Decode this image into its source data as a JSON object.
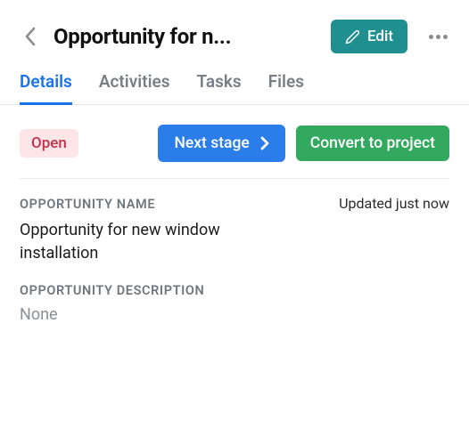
{
  "header": {
    "title": "Opportunity for n...",
    "edit_label": "Edit"
  },
  "tabs": [
    {
      "id": "details",
      "label": "Details",
      "active": true
    },
    {
      "id": "activities",
      "label": "Activities",
      "active": false
    },
    {
      "id": "tasks",
      "label": "Tasks",
      "active": false
    },
    {
      "id": "files",
      "label": "Files",
      "active": false
    }
  ],
  "status": {
    "label": "Open"
  },
  "actions": {
    "next_stage_label": "Next stage",
    "convert_label": "Convert to project"
  },
  "meta": {
    "updated_text": "Updated just now"
  },
  "fields": {
    "opportunity_name": {
      "label": "OPPORTUNITY NAME",
      "value": "Opportunity for new window installation"
    },
    "opportunity_description": {
      "label": "OPPORTUNITY DESCRIPTION",
      "value": "None"
    }
  }
}
